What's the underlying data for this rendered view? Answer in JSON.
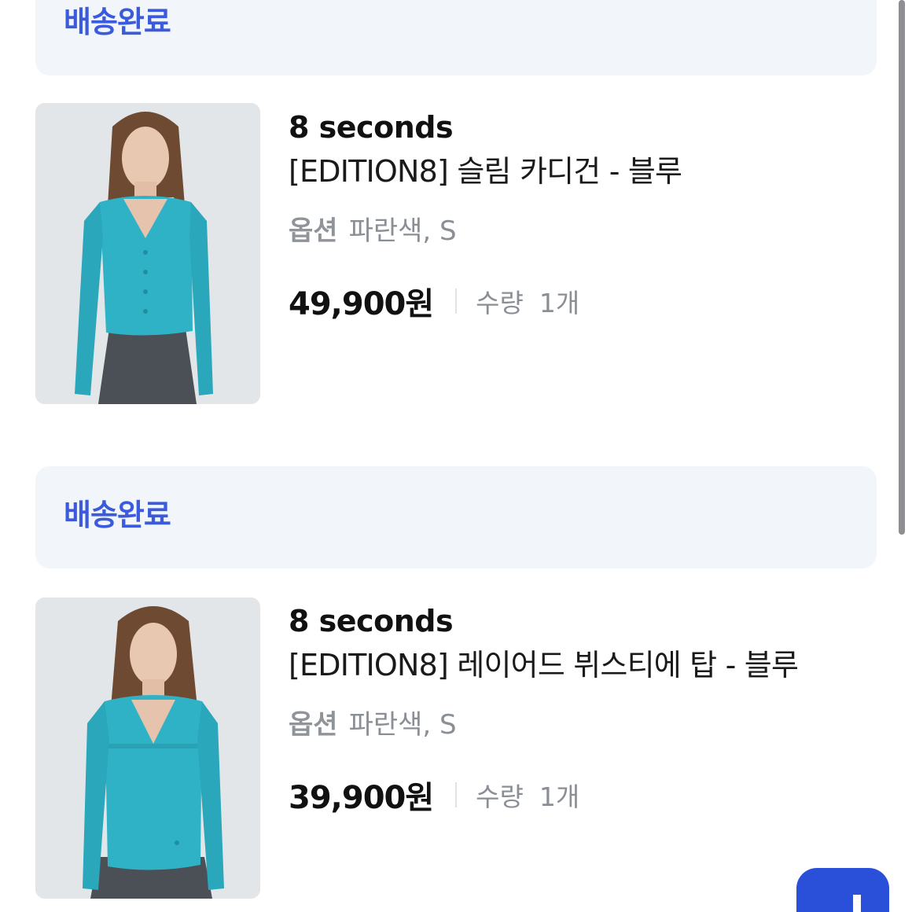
{
  "orders": [
    {
      "status": "배송완료",
      "brand": "8 seconds",
      "product_name": "[EDITION8] 슬림 카디건 - 블루",
      "option_label": "옵션",
      "option_value": "파란색, S",
      "price": "49,900원",
      "quantity_label": "수량",
      "quantity": "1개",
      "image_icon": "product-photo-cardigan"
    },
    {
      "status": "배송완료",
      "brand": "8 seconds",
      "product_name": "[EDITION8] 레이어드 뷔스티에 탑 - 블루",
      "option_label": "옵션",
      "option_value": "파란색, S",
      "price": "39,900원",
      "quantity_label": "수량",
      "quantity": "1개",
      "image_icon": "product-photo-bustier-top"
    }
  ],
  "colors": {
    "status_text": "#3b5bdb",
    "status_bg": "#f2f6fb",
    "garment": "#2fb2c6",
    "fab": "#2a4fd8"
  }
}
